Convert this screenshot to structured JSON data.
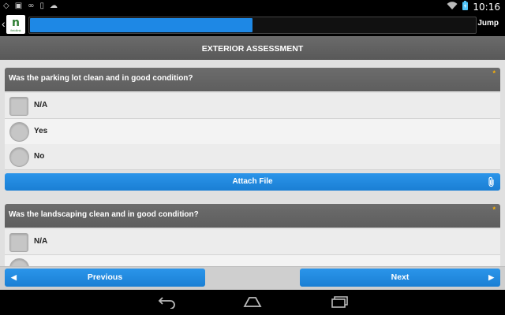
{
  "status_bar": {
    "time": "10:16",
    "icons": [
      "diamond-icon",
      "image-icon",
      "voicemail-icon",
      "phone-icon",
      "gamepad-icon",
      "wifi-icon",
      "battery-icon"
    ]
  },
  "app_bar": {
    "logo_text": "n",
    "logo_subtext": "fieldlink",
    "progress_fraction": 0.5,
    "jump_label": "Jump"
  },
  "section": {
    "title": "EXTERIOR ASSESSMENT"
  },
  "questions": [
    {
      "text": "Was the parking lot clean and in good condition?",
      "required_marker": "*",
      "options": [
        {
          "label": "N/A",
          "control": "checkbox"
        },
        {
          "label": "Yes",
          "control": "radio"
        },
        {
          "label": "No",
          "control": "radio"
        }
      ],
      "attach_label": "Attach File"
    },
    {
      "text": "Was the landscaping clean and in good condition?",
      "required_marker": "*",
      "options": [
        {
          "label": "N/A",
          "control": "checkbox"
        },
        {
          "label": "",
          "control": "radio"
        }
      ]
    }
  ],
  "footer": {
    "previous_label": "Previous",
    "next_label": "Next"
  },
  "colors": {
    "accent": "#1e88e5",
    "header_gray": "#5e5e5e",
    "required": "#ffb300"
  }
}
